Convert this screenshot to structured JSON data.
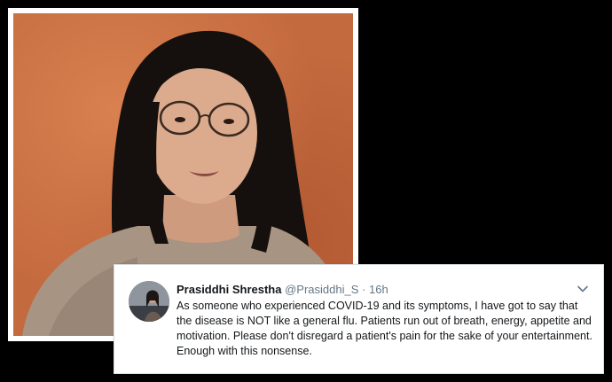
{
  "tweet": {
    "author_name": "Prasiddhi Shrestha",
    "author_handle": "@Prasiddhi_S",
    "separator": "·",
    "time": "16h",
    "text": "As someone who experienced COVID-19 and its symptoms, I have got to say that the disease is NOT like a general flu. Patients run out of breath, energy, appetite and motivation. Please don't disregard a patient's pain for the sake of your entertainment. Enough with this nonsense."
  },
  "icons": {
    "menu": "chevron-down-icon"
  },
  "colors": {
    "background": "#000000",
    "photo_wall": "#c46a3f",
    "name_text": "#14171a",
    "meta_text": "#657786"
  }
}
